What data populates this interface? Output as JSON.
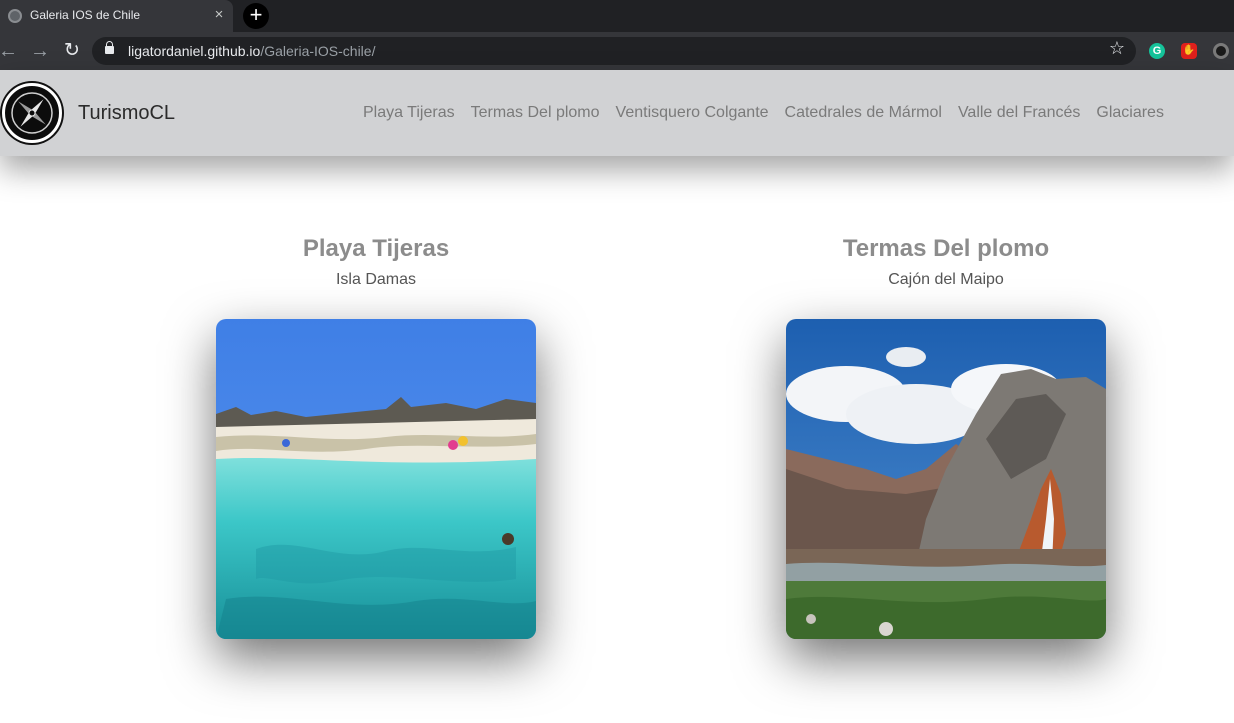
{
  "browser": {
    "tab_title": "Galeria IOS de Chile",
    "tab_close": "×",
    "new_tab": "+",
    "url_host": "ligatordaniel.github.io",
    "url_path": "/Galeria-IOS-chile/",
    "icons": [
      "back-icon",
      "forward-icon",
      "reload-icon",
      "lock-icon",
      "star-icon",
      "grammarly-icon",
      "adblock-icon",
      "chrome-icon"
    ],
    "glyphs": {
      "back": "←",
      "forward": "→",
      "reload": "↻",
      "star": "☆",
      "grammarly": "G",
      "adblock": "✋"
    }
  },
  "navbar": {
    "brand": "TurismoCL",
    "links": [
      "Playa Tijeras",
      "Termas Del plomo",
      "Ventisquero Colgante",
      "Catedrales de Mármol",
      "Valle del Francés",
      "Glaciares"
    ],
    "background": "#d1d2d4"
  },
  "gallery": {
    "cards": [
      {
        "title": "Playa Tijeras",
        "subtitle": "Isla Damas"
      },
      {
        "title": "Termas Del plomo",
        "subtitle": "Cajón del Maipo"
      }
    ]
  }
}
